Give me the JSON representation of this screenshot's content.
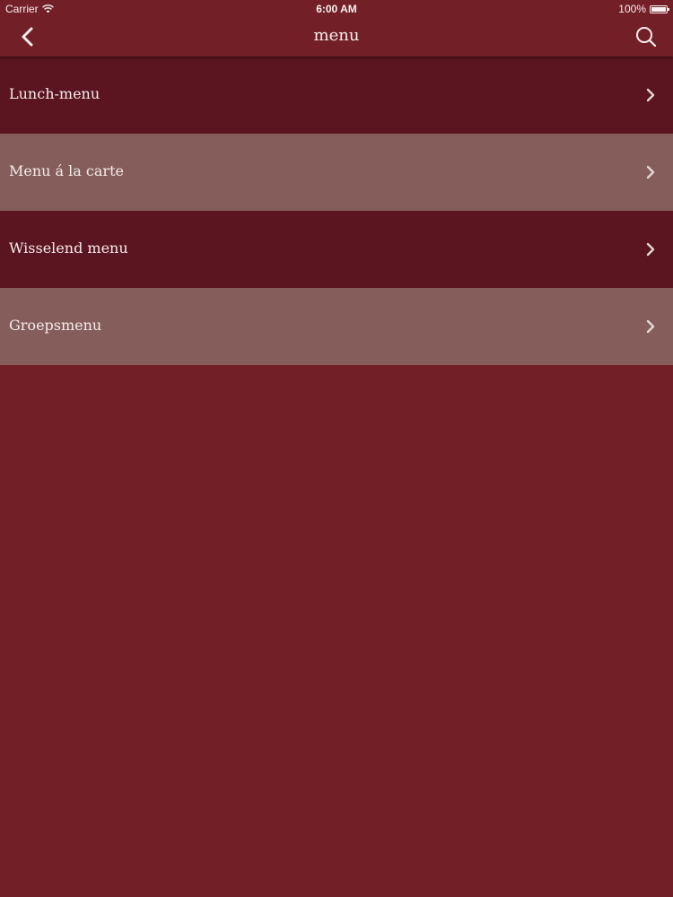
{
  "status_bar": {
    "carrier": "Carrier",
    "time": "6:00 AM",
    "battery": "100%"
  },
  "nav": {
    "title": "menu",
    "back_icon": "chevron-left-icon",
    "search_icon": "search-icon"
  },
  "menu_items": [
    {
      "label": "Lunch-menu"
    },
    {
      "label": "Menu á la carte"
    },
    {
      "label": "Wisselend menu"
    },
    {
      "label": "Groepsmenu"
    }
  ],
  "colors": {
    "background": "#731f28",
    "row_dark": "#5a1520",
    "row_light": "#855e5c",
    "text": "#f4ece9"
  }
}
